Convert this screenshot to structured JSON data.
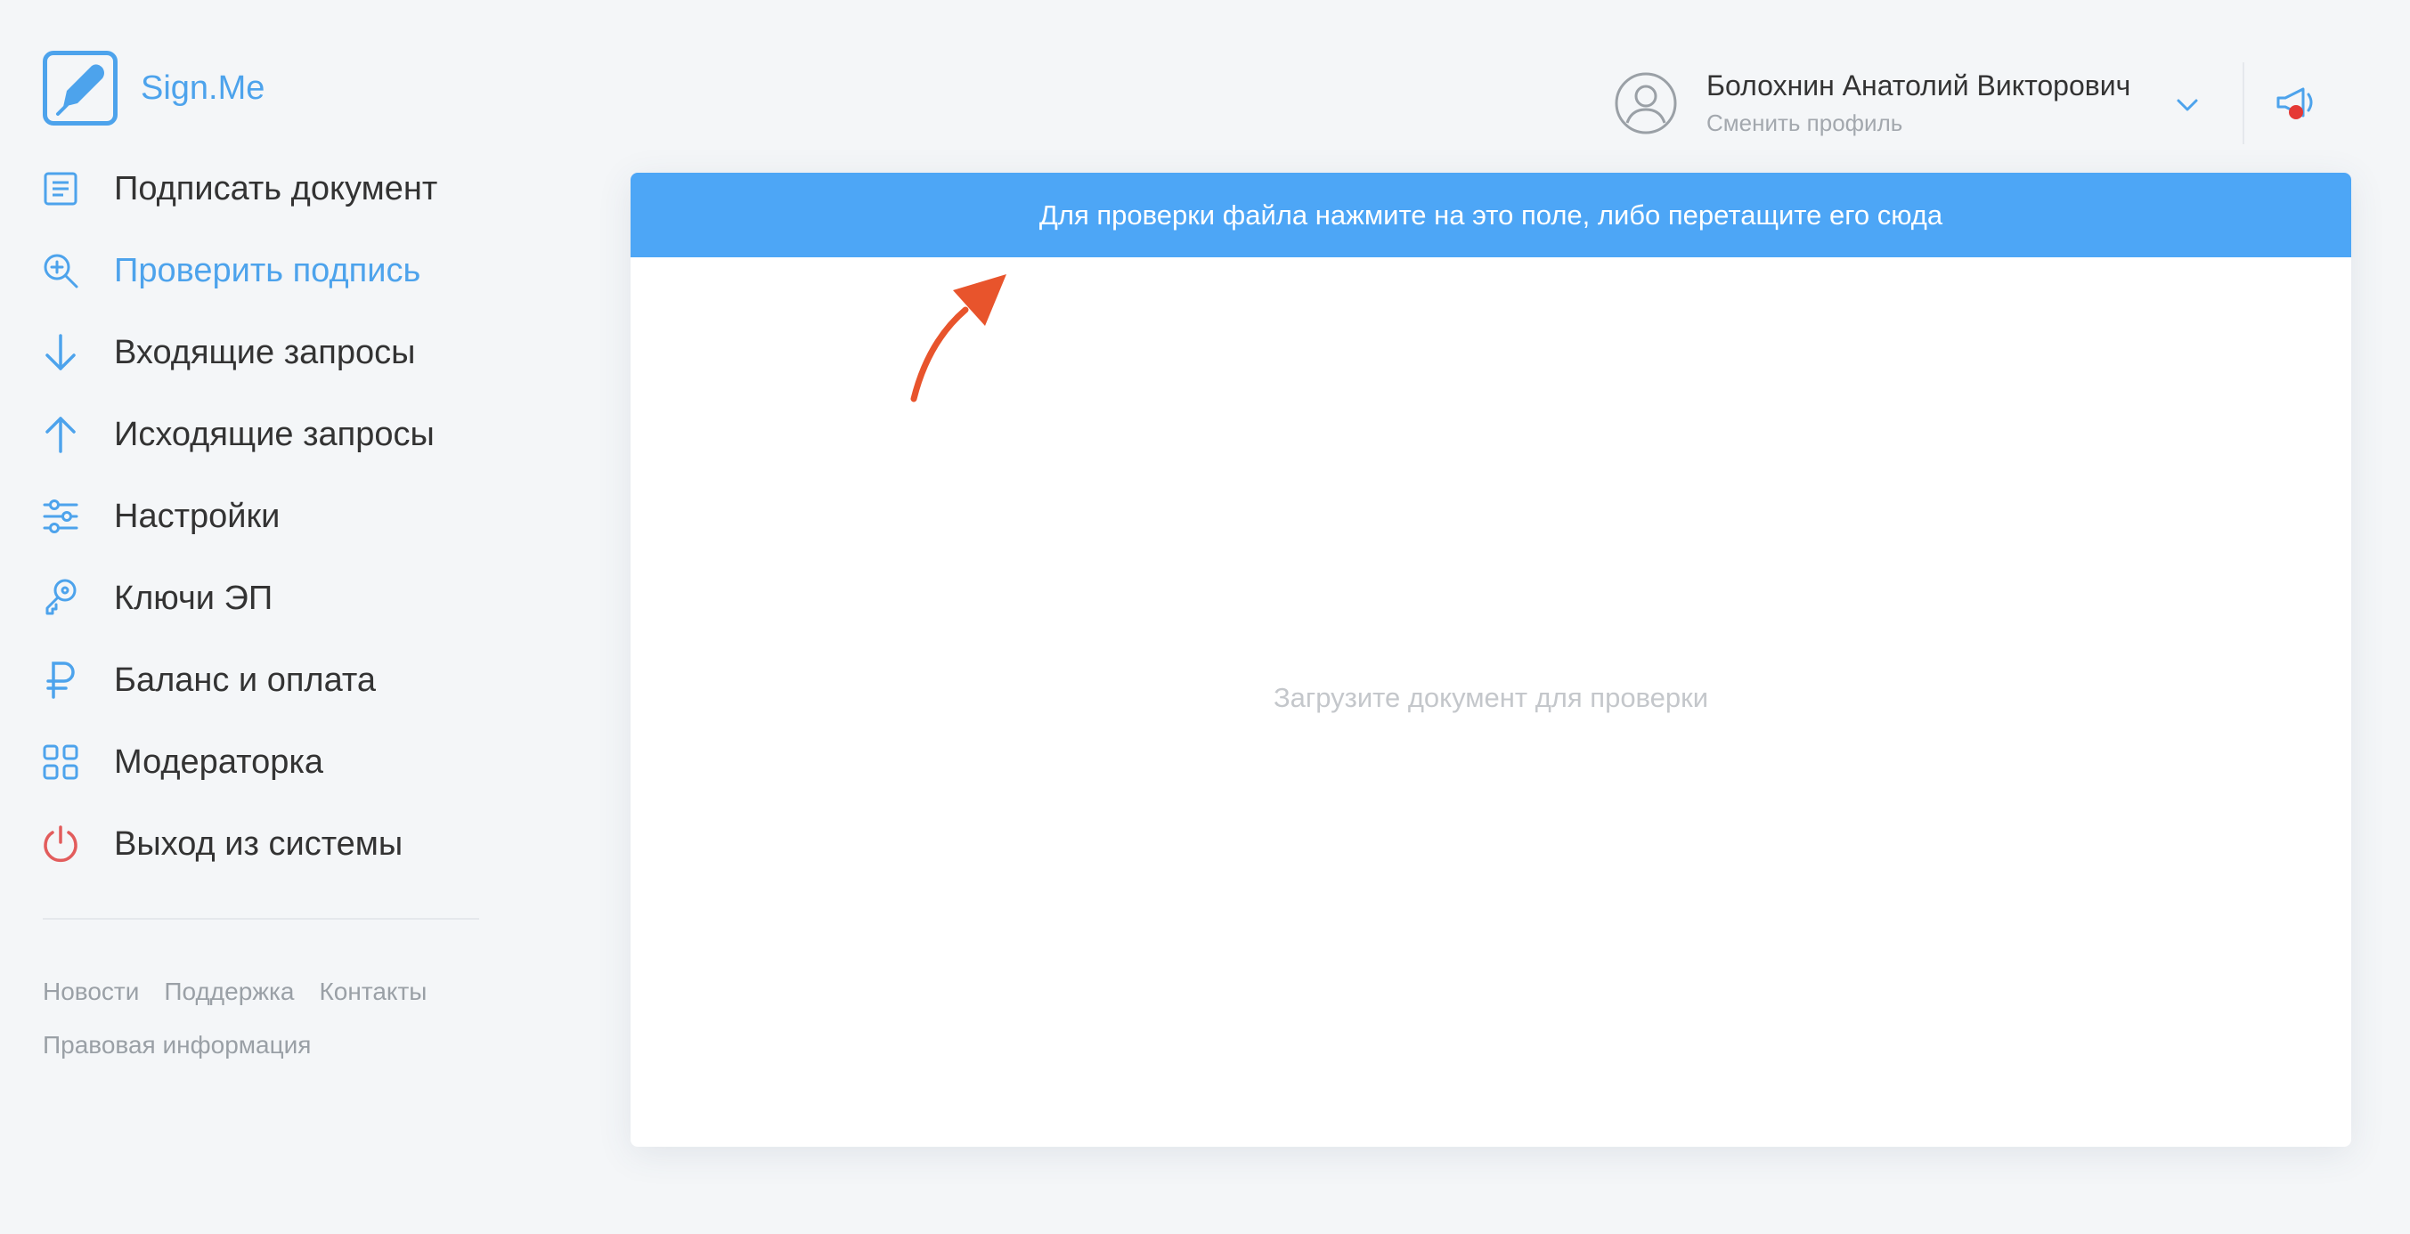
{
  "app": {
    "name": "Sign.Me"
  },
  "sidebar": {
    "items": [
      {
        "label": "Подписать документ",
        "icon": "document-icon"
      },
      {
        "label": "Проверить подпись",
        "icon": "search-check-icon",
        "active": true
      },
      {
        "label": "Входящие запросы",
        "icon": "arrow-down-icon"
      },
      {
        "label": "Исходящие запросы",
        "icon": "arrow-up-icon"
      },
      {
        "label": "Настройки",
        "icon": "sliders-icon"
      },
      {
        "label": "Ключи ЭП",
        "icon": "key-icon"
      },
      {
        "label": "Баланс и оплата",
        "icon": "ruble-icon"
      },
      {
        "label": "Модераторка",
        "icon": "grid-icon"
      },
      {
        "label": "Выход из системы",
        "icon": "power-icon"
      }
    ],
    "footer": {
      "news": "Новости",
      "support": "Поддержка",
      "contacts": "Контакты",
      "legal": "Правовая информация"
    }
  },
  "header": {
    "user_name": "Болохнин Анатолий Викторович",
    "switch_profile": "Сменить профиль"
  },
  "main": {
    "upload_prompt": "Для проверки файла нажмите на это поле, либо перетащите его сюда",
    "empty_state": "Загрузите документ для проверки"
  },
  "colors": {
    "accent": "#4da3ec",
    "upload_bar": "#4da6f6",
    "logout": "#e25c5c",
    "annotation_arrow": "#e8542c",
    "notification_dot": "#e53935"
  }
}
